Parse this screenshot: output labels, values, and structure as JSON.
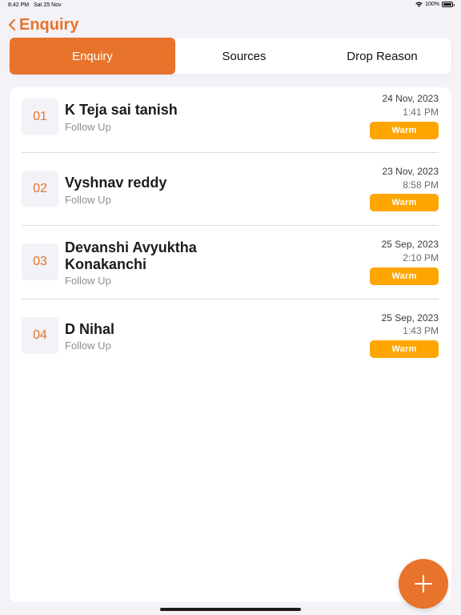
{
  "status_bar": {
    "time": "8:42 PM",
    "date": "Sat 25 Nov",
    "battery": "100%"
  },
  "header": {
    "back_title": "Enquiry"
  },
  "tabs": [
    {
      "label": "Enquiry",
      "active": true
    },
    {
      "label": "Sources",
      "active": false
    },
    {
      "label": "Drop Reason",
      "active": false
    }
  ],
  "enquiries": [
    {
      "number": "01",
      "name": "K Teja sai tanish",
      "subtitle": "Follow Up",
      "date": "24 Nov, 2023",
      "time": "1:41 PM",
      "status": "Warm"
    },
    {
      "number": "02",
      "name": "Vyshnav reddy",
      "subtitle": "Follow Up",
      "date": "23 Nov, 2023",
      "time": "8:58 PM",
      "status": "Warm"
    },
    {
      "number": "03",
      "name": "Devanshi Avyuktha Konakanchi",
      "subtitle": "Follow Up",
      "date": "25 Sep, 2023",
      "time": "2:10 PM",
      "status": "Warm"
    },
    {
      "number": "04",
      "name": "D Nihal",
      "subtitle": "Follow Up",
      "date": "25 Sep, 2023",
      "time": "1:43 PM",
      "status": "Warm"
    }
  ],
  "fab": {
    "icon": "plus-icon"
  },
  "colors": {
    "accent": "#e8732a",
    "badge": "#ffa500",
    "background": "#f2f2f7"
  }
}
